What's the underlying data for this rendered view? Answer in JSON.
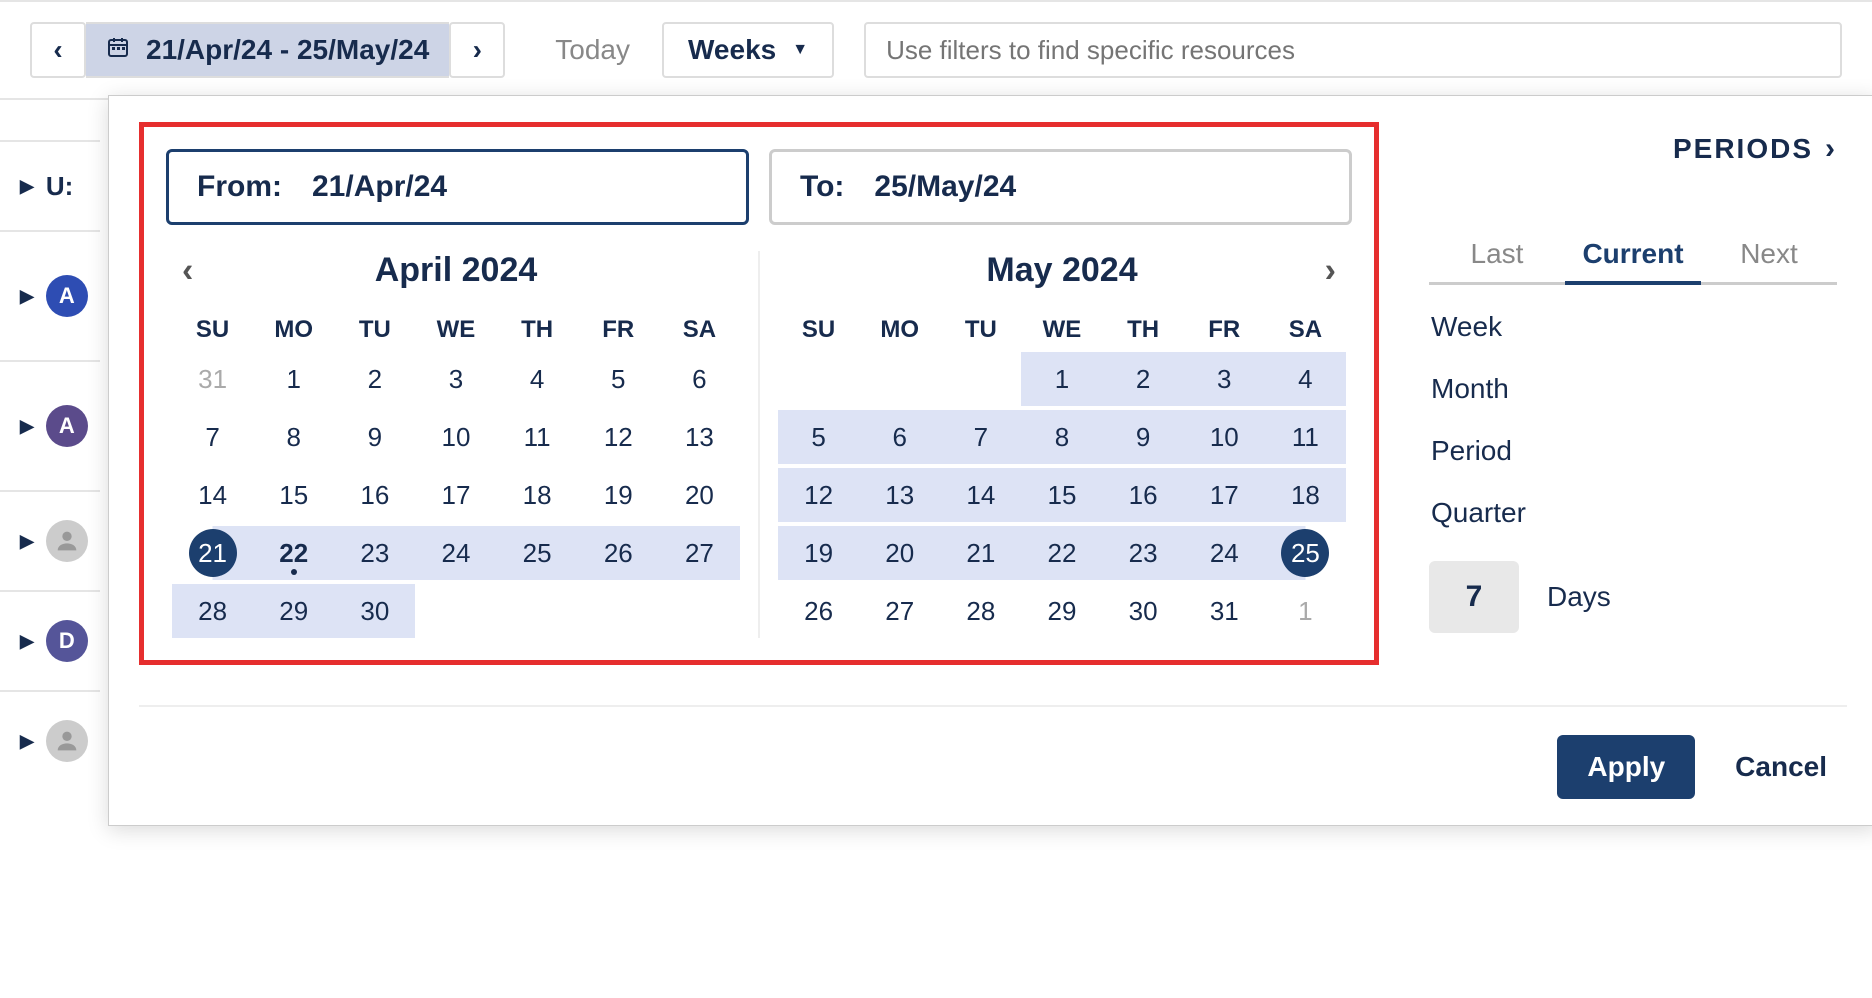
{
  "toolbar": {
    "range_label": "21/Apr/24 - 25/May/24",
    "today_label": "Today",
    "view_label": "Weeks",
    "filter_placeholder": "Use filters to find specific resources"
  },
  "sidebar": {
    "row0": "U:",
    "av1": "A",
    "av2": "A",
    "av4": "D"
  },
  "range": {
    "from_label": "From:",
    "from_value": "21/Apr/24",
    "to_label": "To:",
    "to_value": "25/May/24"
  },
  "dow": [
    "SU",
    "MO",
    "TU",
    "WE",
    "TH",
    "FR",
    "SA"
  ],
  "months": {
    "left": {
      "title": "April 2024",
      "cells": [
        {
          "n": "31",
          "muted": true
        },
        {
          "n": "1"
        },
        {
          "n": "2"
        },
        {
          "n": "3"
        },
        {
          "n": "4"
        },
        {
          "n": "5"
        },
        {
          "n": "6"
        },
        {
          "n": "7"
        },
        {
          "n": "8"
        },
        {
          "n": "9"
        },
        {
          "n": "10"
        },
        {
          "n": "11"
        },
        {
          "n": "12"
        },
        {
          "n": "13"
        },
        {
          "n": "14"
        },
        {
          "n": "15"
        },
        {
          "n": "16"
        },
        {
          "n": "17"
        },
        {
          "n": "18"
        },
        {
          "n": "19"
        },
        {
          "n": "20"
        },
        {
          "n": "21",
          "start": true,
          "range": true
        },
        {
          "n": "22",
          "range": true,
          "today": true
        },
        {
          "n": "23",
          "range": true
        },
        {
          "n": "24",
          "range": true
        },
        {
          "n": "25",
          "range": true
        },
        {
          "n": "26",
          "range": true
        },
        {
          "n": "27",
          "range": true
        },
        {
          "n": "28",
          "range": true
        },
        {
          "n": "29",
          "range": true
        },
        {
          "n": "30",
          "range": true
        }
      ]
    },
    "right": {
      "title": "May 2024",
      "cells": [
        {
          "n": "",
          "blank": true
        },
        {
          "n": "",
          "blank": true
        },
        {
          "n": "",
          "blank": true
        },
        {
          "n": "1",
          "range": true
        },
        {
          "n": "2",
          "range": true
        },
        {
          "n": "3",
          "range": true
        },
        {
          "n": "4",
          "range": true
        },
        {
          "n": "5",
          "range": true
        },
        {
          "n": "6",
          "range": true
        },
        {
          "n": "7",
          "range": true
        },
        {
          "n": "8",
          "range": true
        },
        {
          "n": "9",
          "range": true
        },
        {
          "n": "10",
          "range": true
        },
        {
          "n": "11",
          "range": true
        },
        {
          "n": "12",
          "range": true
        },
        {
          "n": "13",
          "range": true
        },
        {
          "n": "14",
          "range": true
        },
        {
          "n": "15",
          "range": true
        },
        {
          "n": "16",
          "range": true
        },
        {
          "n": "17",
          "range": true
        },
        {
          "n": "18",
          "range": true
        },
        {
          "n": "19",
          "range": true
        },
        {
          "n": "20",
          "range": true
        },
        {
          "n": "21",
          "range": true
        },
        {
          "n": "22",
          "range": true
        },
        {
          "n": "23",
          "range": true
        },
        {
          "n": "24",
          "range": true
        },
        {
          "n": "25",
          "end": true,
          "range": true
        },
        {
          "n": "26"
        },
        {
          "n": "27"
        },
        {
          "n": "28"
        },
        {
          "n": "29"
        },
        {
          "n": "30"
        },
        {
          "n": "31"
        },
        {
          "n": "1",
          "muted": true
        }
      ]
    }
  },
  "periods": {
    "header": "PERIODS",
    "tabs": {
      "last": "Last",
      "current": "Current",
      "next": "Next"
    },
    "items": [
      "Week",
      "Month",
      "Period",
      "Quarter"
    ],
    "days_value": "7",
    "days_label": "Days"
  },
  "footer": {
    "apply": "Apply",
    "cancel": "Cancel"
  }
}
